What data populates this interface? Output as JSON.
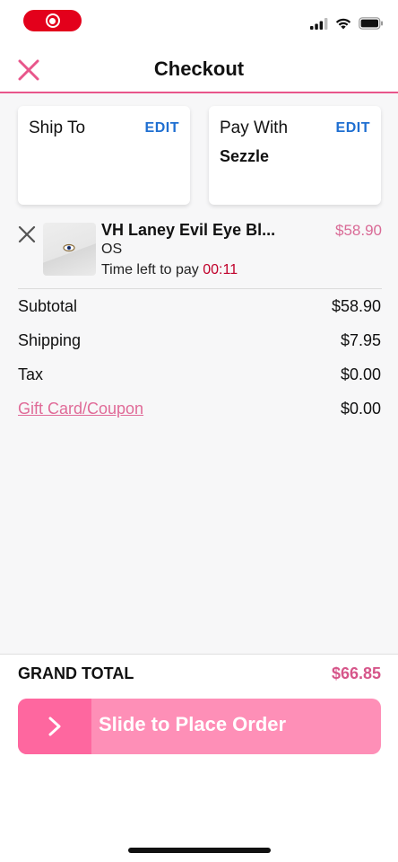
{
  "header": {
    "title": "Checkout"
  },
  "ship_to": {
    "label": "Ship To",
    "edit": "EDIT"
  },
  "pay_with": {
    "label": "Pay With",
    "edit": "EDIT",
    "method": "Sezzle"
  },
  "item": {
    "name": "VH Laney Evil Eye Bl...",
    "price": "$58.90",
    "size": "OS",
    "time_label": "Time left to pay",
    "time_value": "00:11"
  },
  "summary": {
    "subtotal_label": "Subtotal",
    "subtotal_value": "$58.90",
    "shipping_label": "Shipping",
    "shipping_value": "$7.95",
    "tax_label": "Tax",
    "tax_value": "$0.00",
    "coupon_label": "Gift Card/Coupon",
    "coupon_value": "$0.00"
  },
  "grand_total": {
    "label": "GRAND TOTAL",
    "value": "$66.85"
  },
  "slider": {
    "label": "Slide to Place Order"
  },
  "colors": {
    "accent_pink": "#e8568b",
    "link_blue": "#1f6fd1",
    "slider_light": "#fe8fb7",
    "slider_handle": "#fe679f",
    "countdown_red": "#c0002a"
  },
  "icons": {
    "close": "close-icon",
    "remove": "remove-item-icon",
    "slider_arrow": "chevron-right-icon",
    "signal": "cellular-signal-icon",
    "wifi": "wifi-icon",
    "battery": "battery-icon",
    "record": "screen-record-icon"
  }
}
